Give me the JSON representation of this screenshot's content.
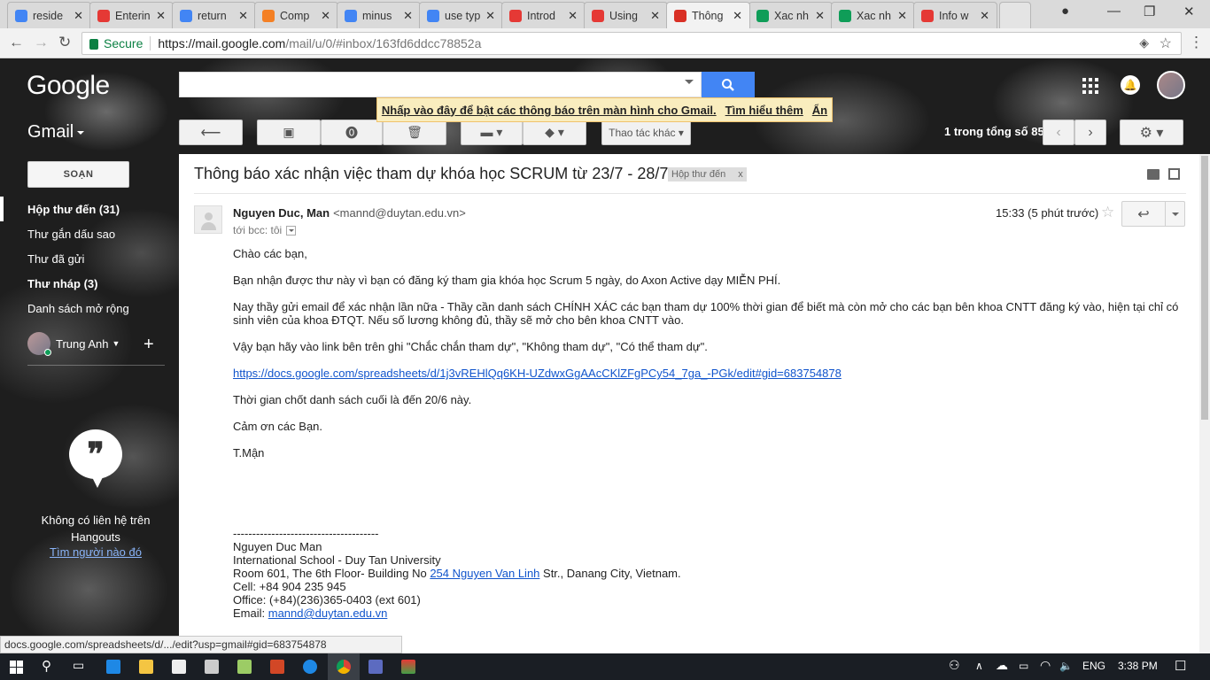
{
  "browser": {
    "tabs": [
      {
        "label": "reside",
        "icon": "google-icon",
        "color": "#4285f4"
      },
      {
        "label": "Enterin",
        "icon": "oracle-icon",
        "color": "#e53935"
      },
      {
        "label": "return",
        "icon": "google-icon",
        "color": "#4285f4"
      },
      {
        "label": "Comp",
        "icon": "stackoverflow-icon",
        "color": "#f48024"
      },
      {
        "label": "minus",
        "icon": "google-icon",
        "color": "#4285f4"
      },
      {
        "label": "use typ",
        "icon": "google-icon",
        "color": "#4285f4"
      },
      {
        "label": "Introd",
        "icon": "oracle-icon",
        "color": "#e53935"
      },
      {
        "label": "Using",
        "icon": "oracle-icon",
        "color": "#e53935"
      },
      {
        "label": "Thông",
        "icon": "gmail-icon",
        "color": "#d93025",
        "active": true
      },
      {
        "label": "Xac nh",
        "icon": "sheets-icon",
        "color": "#0f9d58"
      },
      {
        "label": "Xac nh",
        "icon": "sheets-icon",
        "color": "#0f9d58"
      },
      {
        "label": "Info w",
        "icon": "pdf-icon",
        "color": "#e53935"
      }
    ],
    "secure_label": "Secure",
    "url_host": "https://mail.google.com",
    "url_path": "/mail/u/0/#inbox/163fd6ddcc78852a",
    "status_url": "docs.google.com/spreadsheets/d/.../edit?usp=gmail#gid=683754878"
  },
  "gmail": {
    "logo": "Google",
    "app_label": "Gmail",
    "notice_text": "Nhấp vào đây để bật các thông báo trên màn hình cho Gmail.",
    "notice_learn_more": "Tìm hiểu thêm",
    "notice_hide": "Ẩn",
    "more_actions": "Thao tác khác",
    "page_count": "1 trong tổng số 85",
    "compose": "SOẠN",
    "nav": [
      {
        "label": "Hộp thư đến (31)",
        "bold": true,
        "selected": true
      },
      {
        "label": "Thư gắn dấu sao",
        "bold": false
      },
      {
        "label": "Thư đã gửi",
        "bold": false
      },
      {
        "label": "Thư nháp (3)",
        "bold": true
      },
      {
        "label": "Danh sách mở rộng",
        "bold": false
      }
    ],
    "user_name": "Trung Anh",
    "hangouts_text": "Không có liên hệ trên Hangouts",
    "hangouts_link": "Tìm người nào đó"
  },
  "message": {
    "subject": "Thông báo xác nhận việc tham dự khóa học SCRUM từ 23/7 - 28/7",
    "label": "Hộp thư đến",
    "label_remove": "x",
    "sender_name": "Nguyen Duc, Man",
    "sender_email": "<mannd@duytan.edu.vn>",
    "to": "tới bcc: tôi",
    "time": "15:33 (5 phút trước)",
    "greeting": "Chào các bạn,",
    "p1": "Bạn nhận được thư này vì bạn có đăng ký tham gia khóa học Scrum 5 ngày, do Axon Active dạy MIỄN PHÍ.",
    "p2": "Nay thầy gửi email để xác nhận lần nữa - Thầy cần danh sách CHÍNH XÁC các bạn tham dự 100% thời gian để biết mà còn mở cho các bạn bên khoa CNTT đăng ký vào, hiện tại chỉ có sinh viên của khoa ĐTQT. Nếu số lương không đủ, thầy sẽ mở cho bên khoa CNTT vào.",
    "p3": "Vậy bạn hãy vào link bên trên ghi \"Chắc chắn tham dự\", \"Không tham dự\", \"Có thể tham dự\".",
    "link": "https://docs.google.com/spreadsheets/d/1j3vREHlQq6KH-UZdwxGgAAcCKlZFgPCy54_7ga_-PGk/edit#gid=683754878",
    "p4": "Thời gian chốt danh sách cuối là đến 20/6 này.",
    "p5": "Cảm ơn các Bạn.",
    "p6": "T.Mận",
    "sig_rule": "--------------------------------------",
    "sig_name": "Nguyen Duc Man",
    "sig_org": "International School - Duy Tan University",
    "sig_addr_pre": "Room 601, The 6th Floor- Building No ",
    "sig_addr_link": "254 Nguyen Van Linh",
    "sig_addr_post": " Str., Danang City, Vietnam.",
    "sig_cell": "Cell: +84 904 235 945",
    "sig_office": "Office: (+84)(236)365-0403 (ext 601)",
    "sig_email_label": "Email: ",
    "sig_email": "mannd@duytan.edu.vn"
  },
  "taskbar": {
    "lang": "ENG",
    "clock": "3:38 PM"
  }
}
